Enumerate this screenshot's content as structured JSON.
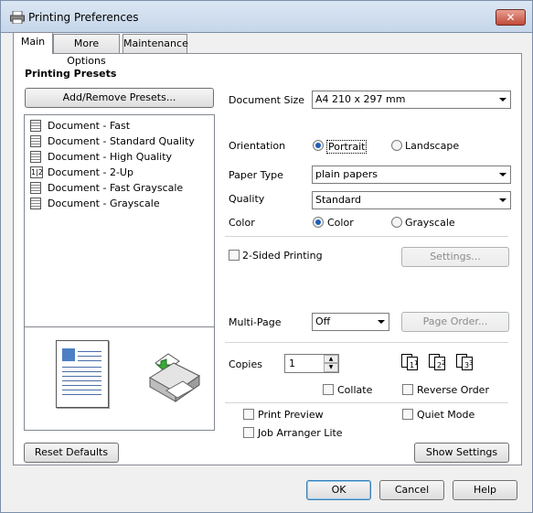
{
  "window": {
    "title": "Printing Preferences",
    "close_label": "✕"
  },
  "tabs": [
    {
      "label": "Main"
    },
    {
      "label": "More Options"
    },
    {
      "label": "Maintenance"
    }
  ],
  "presets": {
    "heading": "Printing Presets",
    "add_remove_label": "Add/Remove Presets...",
    "items": [
      {
        "label": "Document - Fast"
      },
      {
        "label": "Document - Standard Quality"
      },
      {
        "label": "Document - High Quality"
      },
      {
        "label": "Document - 2-Up"
      },
      {
        "label": "Document - Fast Grayscale"
      },
      {
        "label": "Document - Grayscale"
      }
    ],
    "two_up_icon": "1|2"
  },
  "settings": {
    "document_size": {
      "label": "Document Size",
      "value": "A4 210 x 297 mm"
    },
    "orientation": {
      "label": "Orientation",
      "options": [
        "Portrait",
        "Landscape"
      ],
      "selected": "Portrait"
    },
    "paper_type": {
      "label": "Paper Type",
      "value": "plain papers"
    },
    "quality": {
      "label": "Quality",
      "value": "Standard"
    },
    "color": {
      "label": "Color",
      "options": [
        "Color",
        "Grayscale"
      ],
      "selected": "Color"
    },
    "two_sided": {
      "label": "2-Sided Printing",
      "checked": false,
      "settings_label": "Settings..."
    },
    "multi_page": {
      "label": "Multi-Page",
      "value": "Off",
      "page_order_label": "Page Order..."
    },
    "copies": {
      "label": "Copies",
      "value": "1"
    },
    "copy_icons": [
      "1",
      "1",
      "2",
      "2",
      "3",
      "3"
    ],
    "collate": {
      "label": "Collate",
      "checked": false
    },
    "reverse_order": {
      "label": "Reverse Order",
      "checked": false
    },
    "print_preview": {
      "label": "Print Preview",
      "checked": false
    },
    "quiet_mode": {
      "label": "Quiet Mode",
      "checked": false
    },
    "job_arranger": {
      "label": "Job Arranger Lite",
      "checked": false
    }
  },
  "reset_defaults_label": "Reset Defaults",
  "show_settings_label": "Show Settings",
  "footer": {
    "ok": "OK",
    "cancel": "Cancel",
    "help": "Help"
  },
  "colors": {
    "accent": "#1f5fb5",
    "title_bar": "#c6d6ea",
    "close": "#c14a3a",
    "doc_header": "#4d7fc4"
  },
  "icons": {
    "printer": "printer-icon",
    "document_preview": "document-preview-icon"
  }
}
